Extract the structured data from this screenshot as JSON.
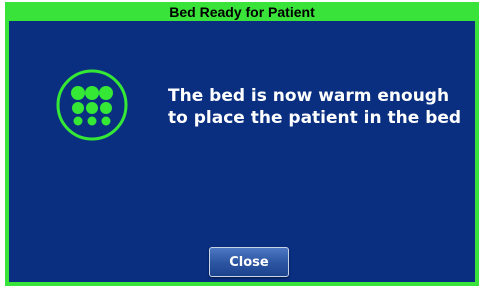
{
  "dialog": {
    "title": "Bed Ready for Patient",
    "message": "The bed is now warm enough to place the patient in the bed",
    "close_label": "Close",
    "icon": "heat-dots-icon"
  },
  "colors": {
    "frame_green": "#3ae33a",
    "panel_blue": "#0a2f80",
    "icon_green": "#35e835",
    "text": "#ffffff"
  }
}
